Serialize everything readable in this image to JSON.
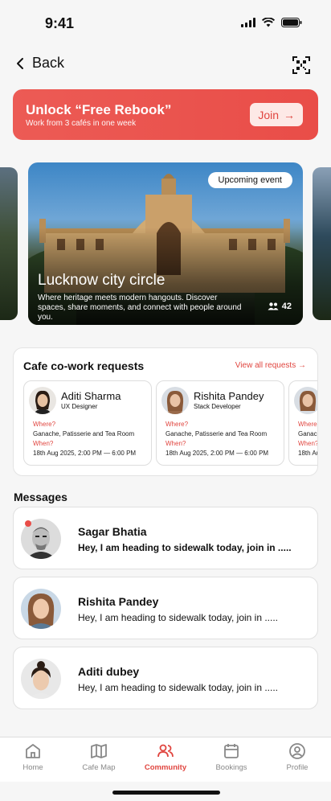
{
  "status": {
    "time": "9:41"
  },
  "nav": {
    "back_label": "Back"
  },
  "promo": {
    "title": "Unlock “Free Rebook”",
    "subtitle": "Work from 3 cafés in one week",
    "join_label": "Join"
  },
  "event": {
    "badge": "Upcoming event",
    "title": "Lucknow city circle",
    "description": "Where heritage meets modern hangouts. Discover spaces, share moments, and connect with people around you.",
    "attendees": "42"
  },
  "requests": {
    "title": "Cafe co-work requests",
    "view_all": "View all requests",
    "where_label": "Where?",
    "when_label": "When?",
    "items": [
      {
        "name": "Aditi Sharma",
        "role": "UX Designer",
        "where": "Ganache, Patisserie and Tea Room",
        "when": "18th Aug 2025, 2:00 PM — 6:00 PM"
      },
      {
        "name": "Rishita Pandey",
        "role": "Stack Developer",
        "where": "Ganache, Patisserie and Tea Room",
        "when": "18th Aug 2025, 2:00 PM — 6:00 PM"
      }
    ]
  },
  "messages": {
    "title": "Messages",
    "items": [
      {
        "name": "Sagar Bhatia",
        "text": "Hey, I am heading to sidewalk today, join in .....",
        "unread": true
      },
      {
        "name": "Rishita Pandey",
        "text": "Hey, I am heading to sidewalk today, join in .....",
        "unread": false
      },
      {
        "name": "Aditi dubey",
        "text": "Hey, I am heading to sidewalk today, join in .....",
        "unread": false
      }
    ]
  },
  "tabs": [
    {
      "label": "Home",
      "icon": "home-icon"
    },
    {
      "label": "Cafe Map",
      "icon": "map-icon"
    },
    {
      "label": "Community",
      "icon": "community-icon",
      "active": true
    },
    {
      "label": "Bookings",
      "icon": "calendar-icon"
    },
    {
      "label": "Profile",
      "icon": "profile-icon"
    }
  ],
  "colors": {
    "accent": "#e94d48",
    "background": "#f6f6f6"
  }
}
